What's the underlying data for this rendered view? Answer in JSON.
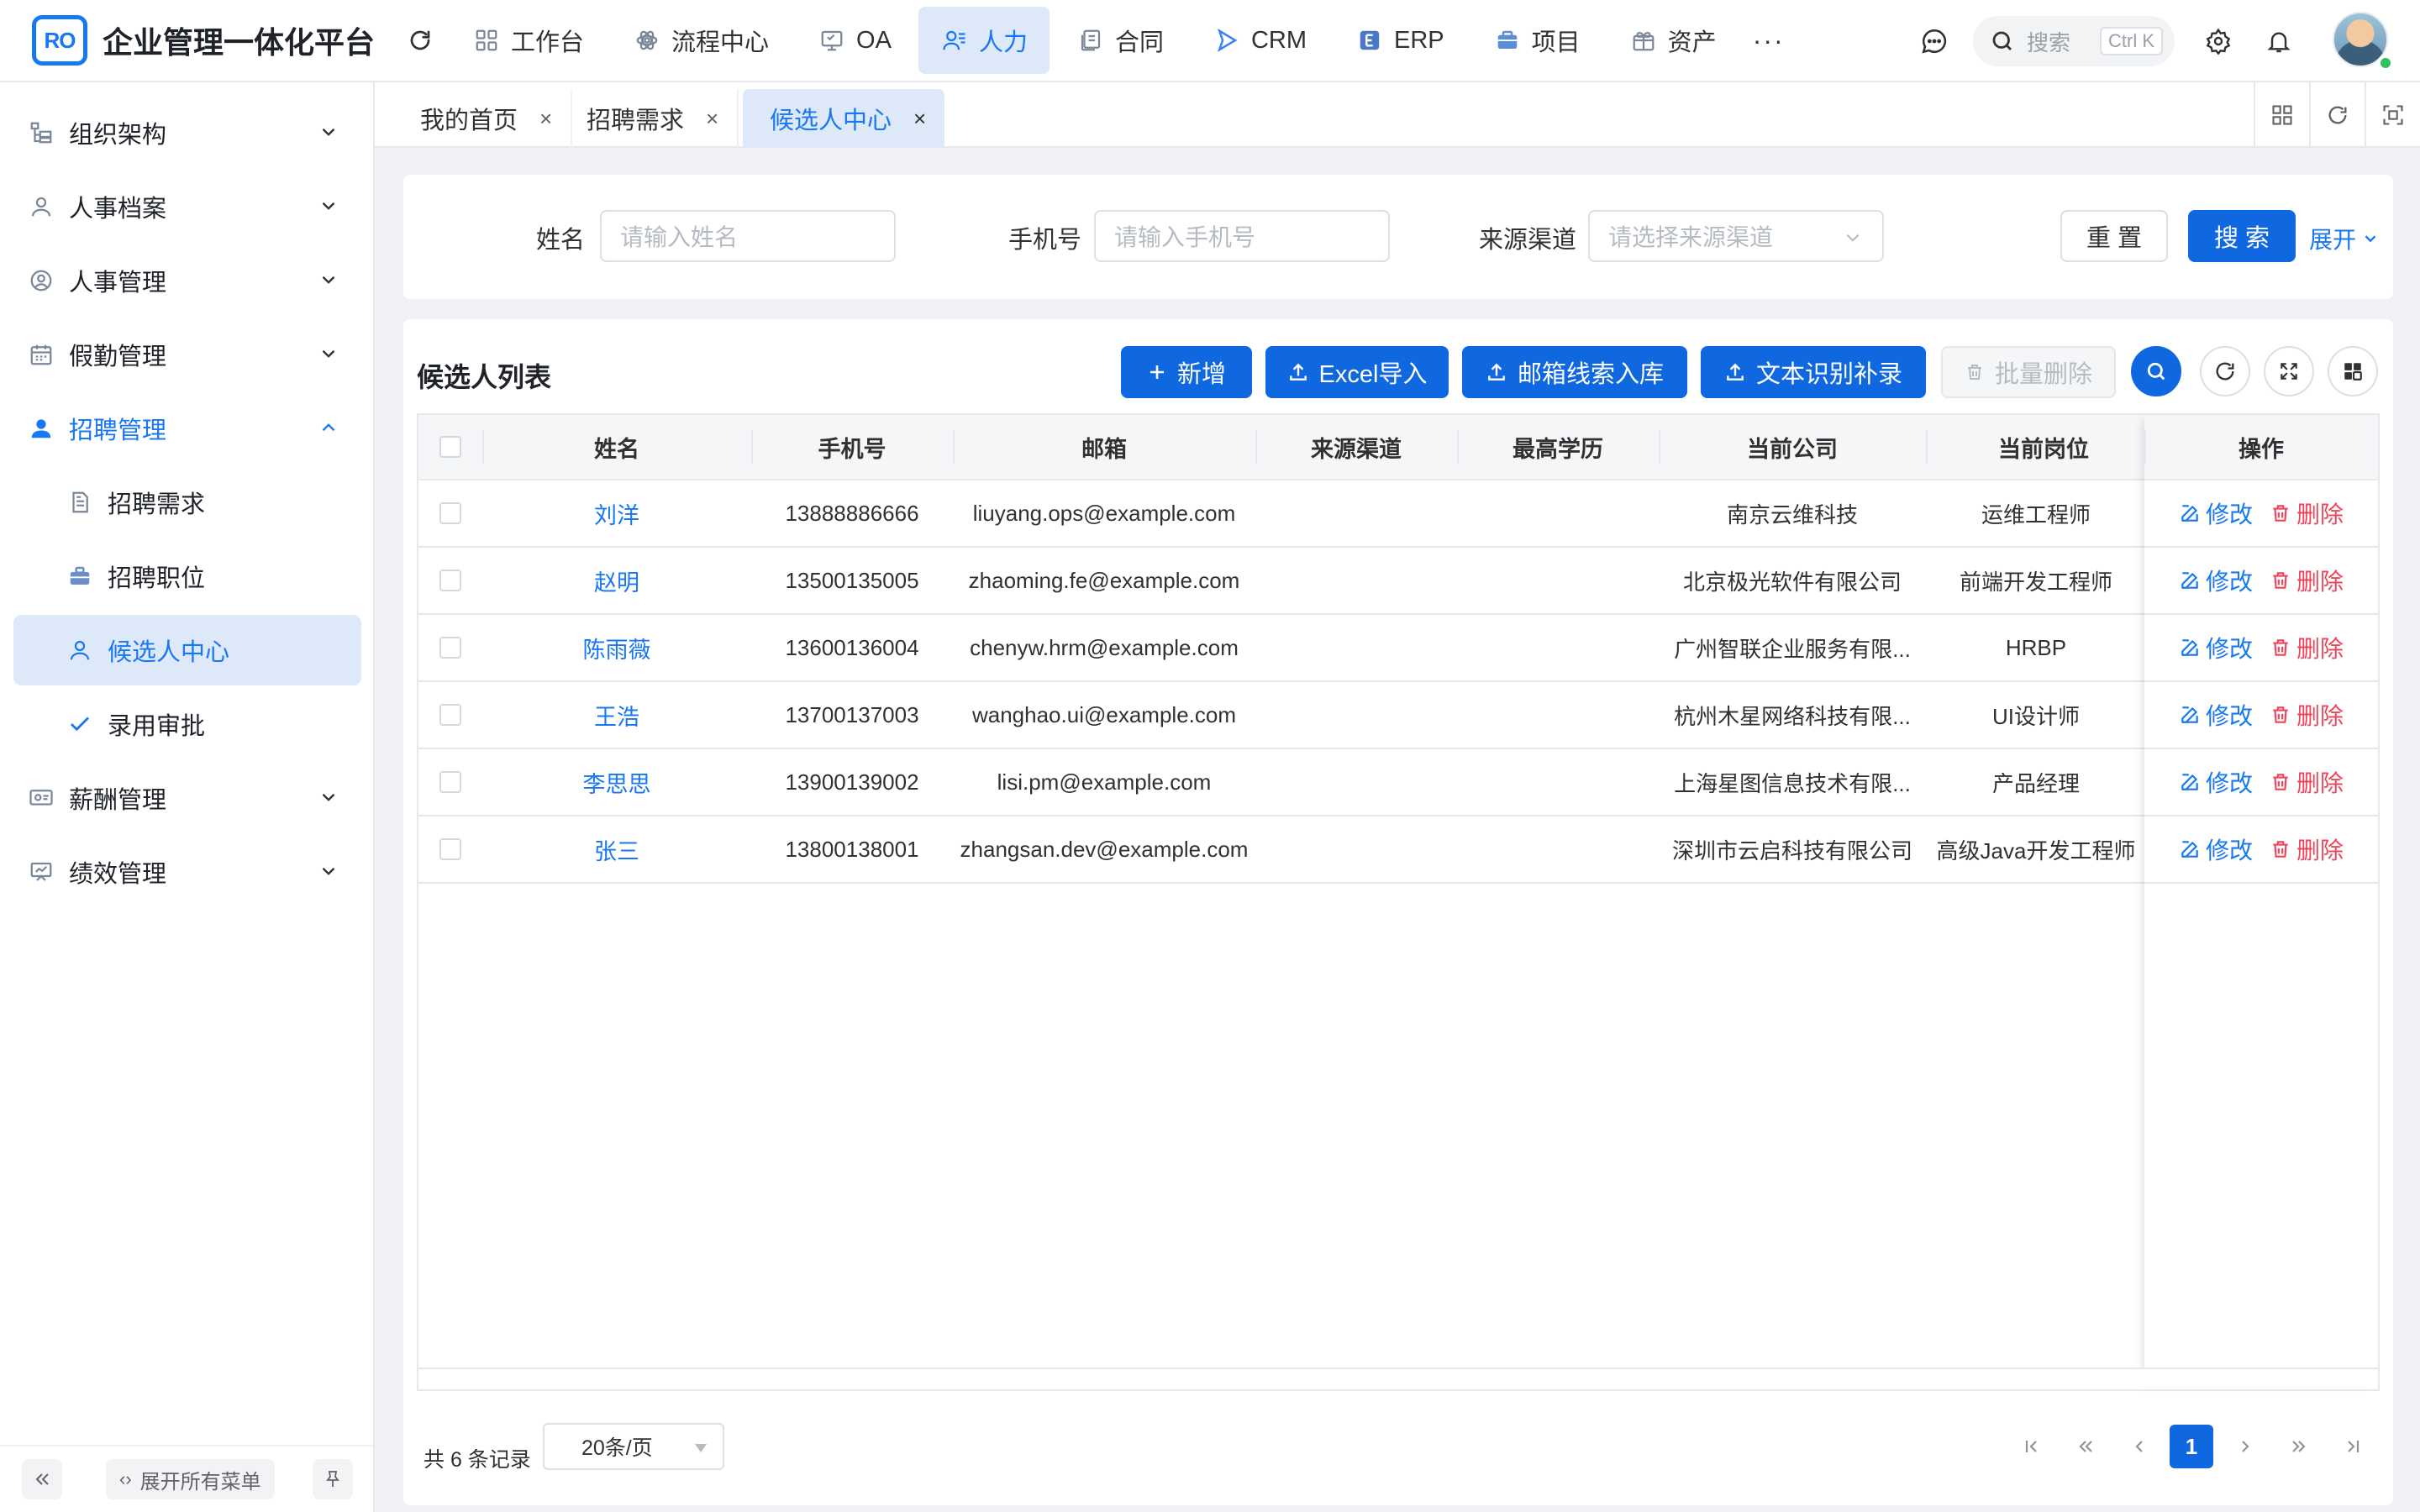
{
  "app": {
    "logo_text": "RO",
    "title": "企业管理一体化平台"
  },
  "topnav": [
    {
      "label": "工作台",
      "icon": "dashboard-icon"
    },
    {
      "label": "流程中心",
      "icon": "workflow-icon"
    },
    {
      "label": "OA",
      "icon": "oa-icon"
    },
    {
      "label": "人力",
      "icon": "people-icon",
      "active": true
    },
    {
      "label": "合同",
      "icon": "contract-icon"
    },
    {
      "label": "CRM",
      "icon": "crm-icon"
    },
    {
      "label": "ERP",
      "icon": "erp-icon"
    },
    {
      "label": "项目",
      "icon": "project-icon"
    },
    {
      "label": "资产",
      "icon": "asset-icon"
    }
  ],
  "header_tools": {
    "more": "···",
    "search_placeholder": "搜索",
    "search_shortcut": "Ctrl K"
  },
  "sidebar": {
    "items": [
      {
        "label": "组织架构",
        "icon": "org-chart-icon"
      },
      {
        "label": "人事档案",
        "icon": "user-file-icon"
      },
      {
        "label": "人事管理",
        "icon": "user-circle-icon"
      },
      {
        "label": "假勤管理",
        "icon": "calendar-icon"
      },
      {
        "label": "招聘管理",
        "icon": "recruit-icon",
        "open": true
      },
      {
        "label": "招聘需求",
        "icon": "document-icon",
        "sub": true
      },
      {
        "label": "招聘职位",
        "icon": "briefcase-icon",
        "sub": true
      },
      {
        "label": "候选人中心",
        "icon": "candidate-icon",
        "sub": true,
        "active": true
      },
      {
        "label": "录用审批",
        "icon": "check-icon",
        "sub": true
      },
      {
        "label": "薪酬管理",
        "icon": "salary-icon"
      },
      {
        "label": "绩效管理",
        "icon": "performance-icon"
      }
    ],
    "footer": {
      "expand_all": "展开所有菜单"
    }
  },
  "tabs": [
    {
      "label": "我的首页",
      "close": "×"
    },
    {
      "label": "招聘需求",
      "close": "×"
    },
    {
      "label": "候选人中心",
      "close": "×",
      "active": true
    }
  ],
  "filter": {
    "name_label": "姓名",
    "name_placeholder": "请输入姓名",
    "phone_label": "手机号",
    "phone_placeholder": "请输入手机号",
    "source_label": "来源渠道",
    "source_placeholder": "请选择来源渠道",
    "reset": "重 置",
    "search": "搜 索",
    "expand": "展开"
  },
  "list": {
    "title": "候选人列表",
    "actions": {
      "add": "新增",
      "excel_import": "Excel导入",
      "email_import": "邮箱线索入库",
      "ocr_import": "文本识别补录",
      "batch_delete": "批量删除"
    },
    "columns": [
      "姓名",
      "手机号",
      "邮箱",
      "来源渠道",
      "最高学历",
      "当前公司",
      "当前岗位",
      "操作"
    ],
    "row_actions": {
      "edit": "修改",
      "delete": "删除"
    },
    "rows": [
      {
        "name": "刘洋",
        "phone": "13888886666",
        "email": "liuyang.ops@example.com",
        "source": "",
        "education": "",
        "company": "南京云维科技",
        "position": "运维工程师"
      },
      {
        "name": "赵明",
        "phone": "13500135005",
        "email": "zhaoming.fe@example.com",
        "source": "",
        "education": "",
        "company": "北京极光软件有限公司",
        "position": "前端开发工程师"
      },
      {
        "name": "陈雨薇",
        "phone": "13600136004",
        "email": "chenyw.hrm@example.com",
        "source": "",
        "education": "",
        "company": "广州智联企业服务有限...",
        "position": "HRBP"
      },
      {
        "name": "王浩",
        "phone": "13700137003",
        "email": "wanghao.ui@example.com",
        "source": "",
        "education": "",
        "company": "杭州木星网络科技有限...",
        "position": "UI设计师"
      },
      {
        "name": "李思思",
        "phone": "13900139002",
        "email": "lisi.pm@example.com",
        "source": "",
        "education": "",
        "company": "上海星图信息技术有限...",
        "position": "产品经理"
      },
      {
        "name": "张三",
        "phone": "13800138001",
        "email": "zhangsan.dev@example.com",
        "source": "",
        "education": "",
        "company": "深圳市云启科技有限公司",
        "position": "高级Java开发工程师"
      }
    ]
  },
  "pagination": {
    "total_text": "共 6 条记录",
    "page_size": "20条/页",
    "current_page": "1"
  },
  "colors": {
    "primary": "#1068e0",
    "link": "#1877f2",
    "danger": "#f0445a",
    "active_bg": "#dde8f8"
  }
}
